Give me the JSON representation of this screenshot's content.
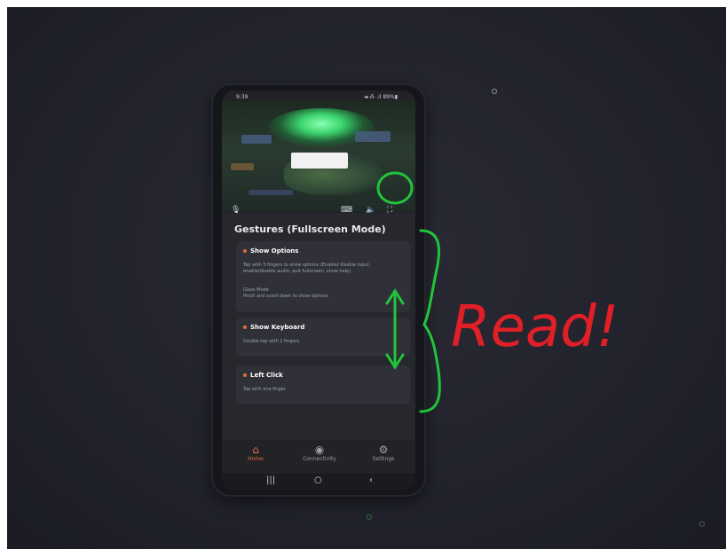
{
  "photo": {
    "background_color": "#22232c",
    "dust_specks": [
      {
        "label": "dust-speck"
      },
      {
        "label": "dust-speck"
      },
      {
        "label": "dust-speck"
      }
    ]
  },
  "phone": {
    "status_bar": {
      "time": "9:39",
      "system": "◄ ⁂ .ıl 89%▮"
    },
    "stream_controls": {
      "mic": "🎙",
      "keyboard": "⌨",
      "volume": "🔈",
      "fullscreen": "⛶"
    },
    "sheet_title": "Gestures (Fullscreen Mode)",
    "cards": [
      {
        "title": "Show Options",
        "description": "Tap with 3 fingers to show options (Enable/ disable input, enable/disable audio, quit fullscreen, show help)",
        "extra_title": "Glass Mode",
        "extra_description": "Pinch and scroll down to show options"
      },
      {
        "title": "Show Keyboard",
        "description": "Double tap with 2 fingers"
      },
      {
        "title": "Left Click",
        "description": "Tap with one finger"
      }
    ],
    "tabs": [
      {
        "label": "Home",
        "icon": "home-icon",
        "active": true
      },
      {
        "label": "Connectivity",
        "icon": "connectivity-icon",
        "active": false
      },
      {
        "label": "Settings",
        "icon": "settings-icon",
        "active": false
      }
    ],
    "nav": {
      "recents": "|||",
      "home": "○",
      "back": "‹"
    },
    "accent_color": "#e0713b"
  },
  "annotations": {
    "handwritten_text": "Read!",
    "colors": {
      "green": "#22c43b",
      "red": "#e01f27"
    }
  }
}
